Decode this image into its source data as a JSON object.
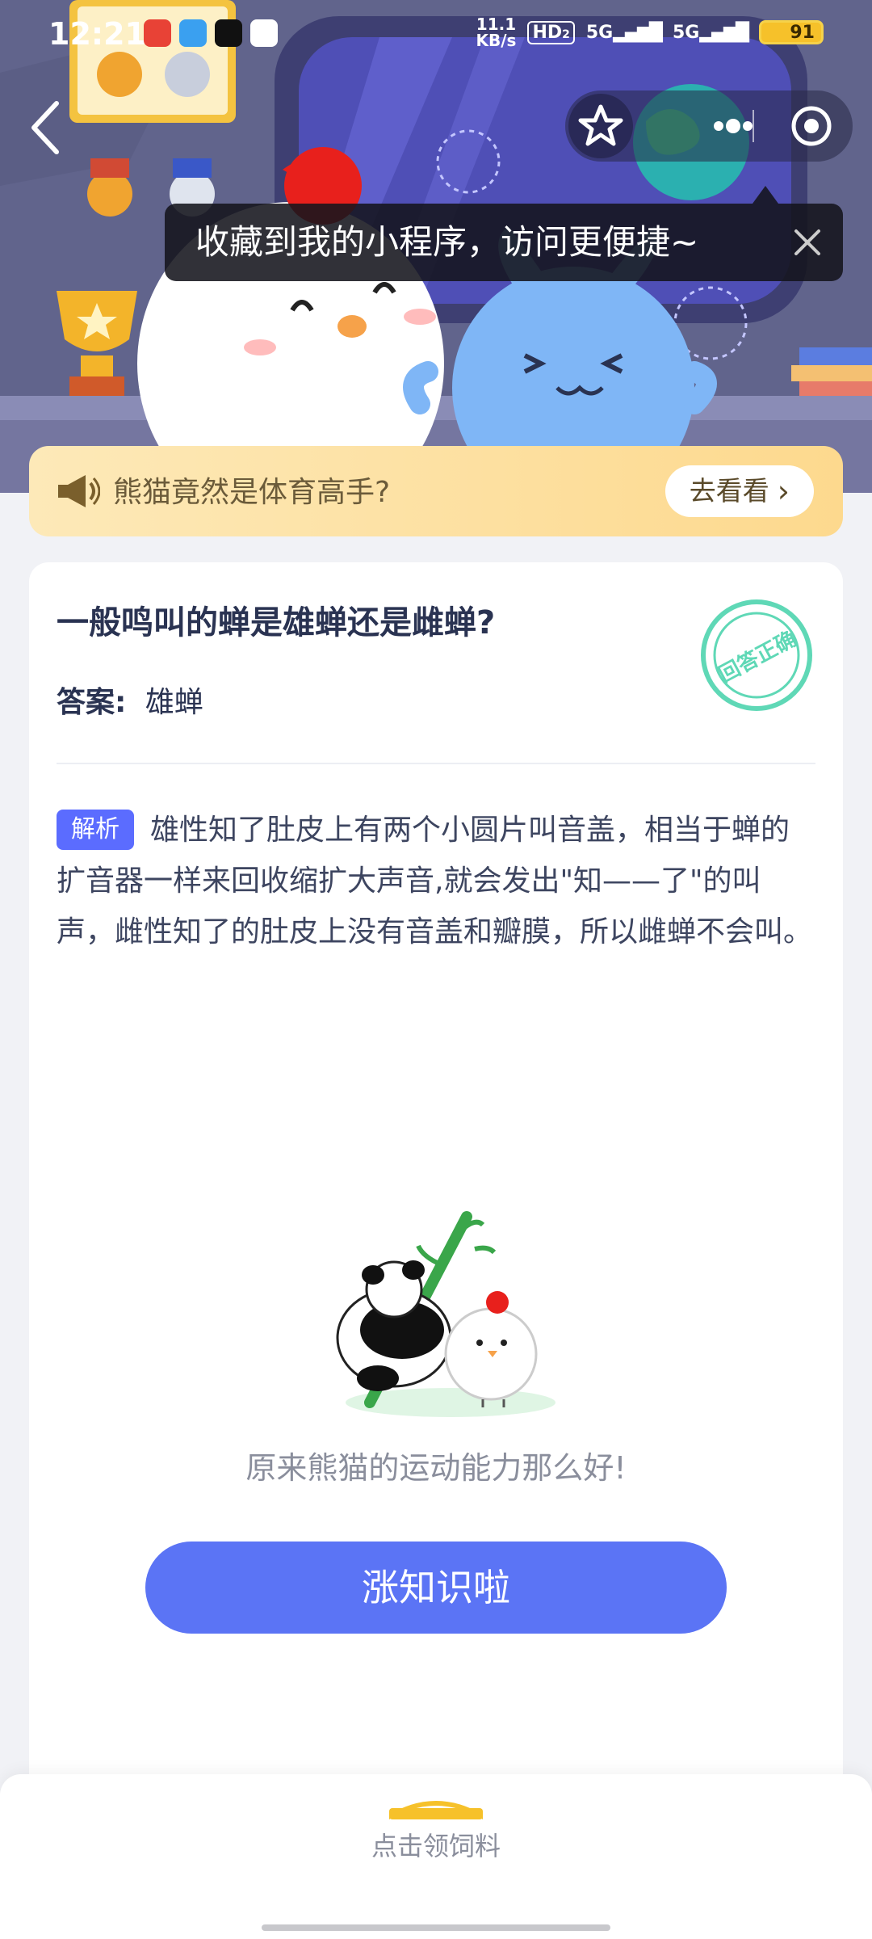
{
  "status_bar": {
    "time": "12:21",
    "net_speed_value": "11.1",
    "net_speed_unit": "KB/s",
    "hd_label": "HD",
    "hd_sub": "2",
    "signal_1": "5G",
    "signal_2": "5G",
    "battery": "91"
  },
  "tooltip": {
    "text": "收藏到我的小程序，访问更便捷~"
  },
  "notice": {
    "text": "熊猫竟然是体育高手?",
    "button_label": "去看看",
    "button_chevron": "›"
  },
  "card": {
    "question": "一般鸣叫的蝉是雄蝉还是雌蝉?",
    "answer_label": "答案:",
    "answer_value": "雄蝉",
    "stamp_text": "回答正确",
    "analysis_badge": "解析",
    "analysis_text": "雄性知了肚皮上有两个小圆片叫音盖，相当于蝉的扩音器一样来回收缩扩大声音,就会发出\"知——了\"的叫声，雌性知了的肚皮上没有音盖和瓣膜，所以雌蝉不会叫。",
    "caption": "原来熊猫的运动能力那么好!",
    "cta_label": "涨知识啦"
  },
  "bottom_tab": {
    "label": "点击领饲料"
  },
  "colors": {
    "accent_blue": "#5b74f5",
    "badge_blue": "#5b6cff",
    "notice_bg": "#fddf9e",
    "stamp_green": "#5fd8b6",
    "hero_bg": "#5b5f86"
  }
}
